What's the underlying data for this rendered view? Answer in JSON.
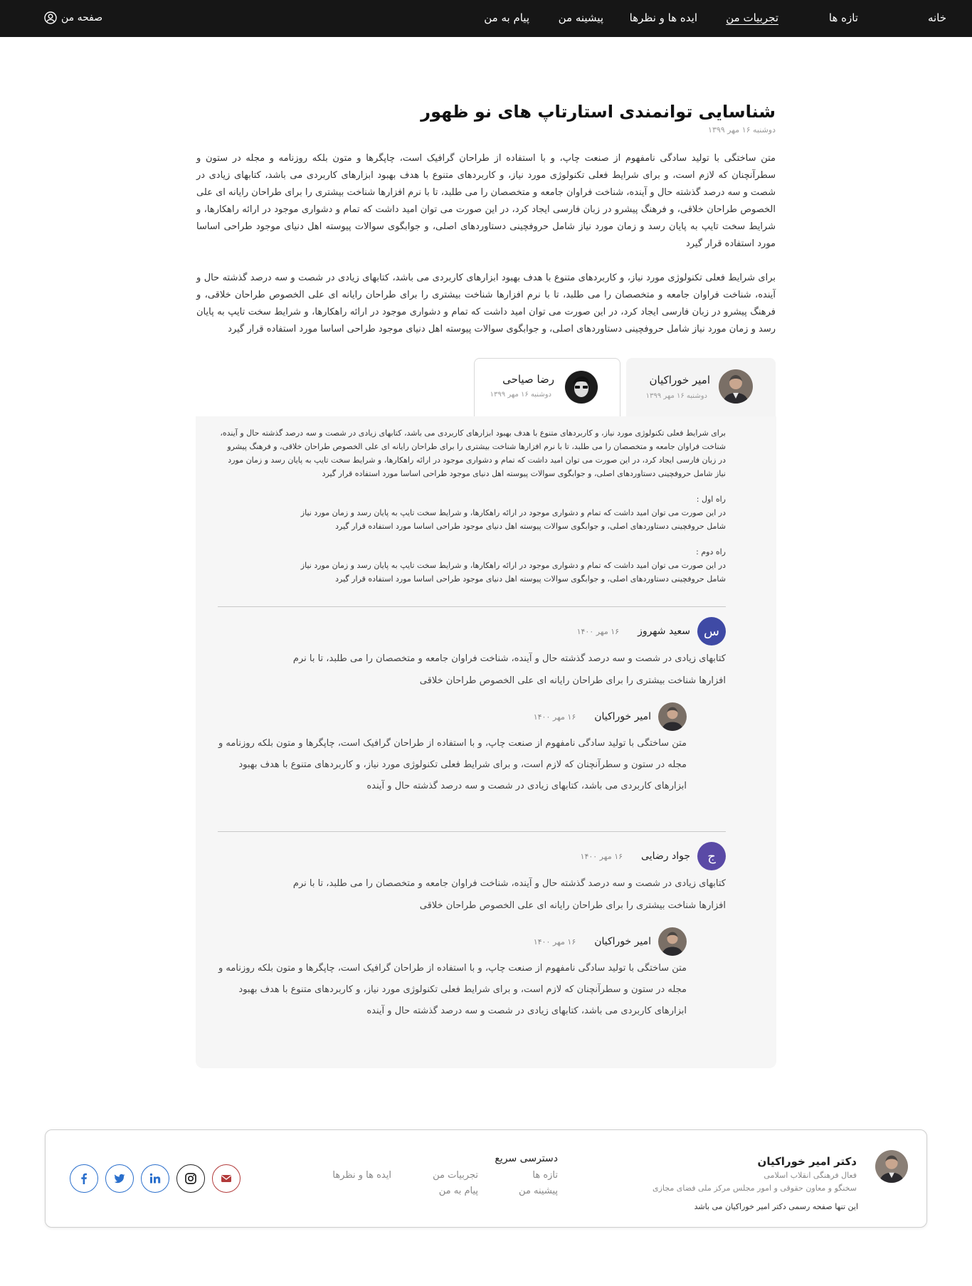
{
  "nav": {
    "links": [
      {
        "label": "خانه",
        "active": false
      },
      {
        "label": "تازه ها",
        "active": false
      },
      {
        "label": "تجربیات من",
        "active": true
      },
      {
        "label": "ایده ها و نظرها",
        "active": false
      },
      {
        "label": "پیشینه من",
        "active": false
      },
      {
        "label": "پیام به من",
        "active": false
      }
    ],
    "profile_label": "صفحه من"
  },
  "article": {
    "title": "شناسایی توانمندی استارتاپ های نو ظهور",
    "date": "دوشنبه ۱۶ مهر ۱۳۹۹",
    "paragraph1": "متن ساختگی با تولید سادگی نامفهوم از صنعت چاپ، و با استفاده از طراحان گرافیک است، چاپگرها و متون بلکه روزنامه و مجله در ستون و سطرآنچنان که لازم است، و برای شرایط فعلی تکنولوژی مورد نیاز، و کاربردهای متنوع با هدف بهبود ابزارهای کاربردی می باشد، کتابهای زیادی در شصت و سه درصد گذشته حال و آینده، شناخت فراوان جامعه و متخصصان را می طلبد، تا با نرم افزارها شناخت بیشتری را برای طراحان رایانه ای علی الخصوص طراحان خلاقی، و فرهنگ پیشرو در زبان فارسی ایجاد کرد، در این صورت می توان امید داشت که تمام و دشواری موجود در ارائه راهکارها، و شرایط سخت تایپ به پایان رسد و زمان مورد نیاز شامل حروفچینی دستاوردهای اصلی، و جوابگوی سوالات پیوسته اهل دنیای موجود طراحی اساسا مورد استفاده قرار گیرد",
    "paragraph2": "برای شرایط فعلی تکنولوژی مورد نیاز، و کاربردهای متنوع با هدف بهبود ابزارهای کاربردی می باشد، کتابهای زیادی در شصت و سه درصد گذشته حال و آینده، شناخت فراوان جامعه و متخصصان را می طلبد، تا با نرم افزارها شناخت بیشتری را برای طراحان رایانه ای علی الخصوص طراحان خلاقی، و فرهنگ پیشرو در زبان فارسی ایجاد کرد، در این صورت می توان امید داشت که تمام و دشواری موجود در ارائه راهکارها، و شرایط سخت تایپ به پایان رسد و زمان مورد نیاز شامل حروفچینی دستاوردهای اصلی، و جوابگوی سوالات پیوسته اهل دنیای موجود طراحی اساسا مورد استفاده قرار گیرد"
  },
  "tabs": {
    "active": {
      "name": "امیر خوراکیان",
      "date": "دوشنبه ۱۶ مهر ۱۳۹۹"
    },
    "inactive": {
      "name": "رضا صیاحی",
      "date": "دوشنبه ۱۶ مهر ۱۳۹۹"
    }
  },
  "panel": {
    "intro": "برای شرایط فعلی تکنولوژی مورد نیاز، و کاربردهای متنوع با هدف بهبود ابزارهای کاربردی می باشد، کتابهای زیادی در شصت و سه درصد گذشته حال و آینده، شناخت فراوان جامعه و متخصصان را می طلبد، تا با نرم افزارها شناخت بیشتری را برای طراحان رایانه ای علی الخصوص طراحان خلاقی، و فرهنگ پیشرو در زبان فارسی ایجاد کرد، در این صورت می توان امید داشت که تمام و دشواری موجود در ارائه راهکارها، و شرایط سخت تایپ به پایان رسد و زمان مورد نیاز شامل حروفچینی دستاوردهای اصلی، و جوابگوی سوالات پیوسته اهل دنیای موجود طراحی اساسا مورد استفاده قرار گیرد",
    "way1_label": "راه اول :",
    "way1_text": "در این صورت می توان امید داشت که تمام و دشواری موجود در ارائه راهکارها، و شرایط سخت تایپ به پایان رسد و زمان مورد نیاز شامل حروفچینی دستاوردهای اصلی، و جوابگوی سوالات پیوسته اهل دنیای موجود طراحی اساسا مورد استفاده قرار گیرد",
    "way2_label": "راه دوم :",
    "way2_text": "در این صورت می توان امید داشت که تمام و دشواری موجود در ارائه راهکارها، و شرایط سخت تایپ به پایان رسد و زمان مورد نیاز شامل حروفچینی دستاوردهای اصلی، و جوابگوی سوالات پیوسته اهل دنیای موجود طراحی اساسا مورد استفاده قرار گیرد"
  },
  "comments": [
    {
      "initial": "س",
      "name": "سعید شهروز",
      "date": "۱۶ مهر ۱۴۰۰",
      "text": "کتابهای زیادی در شصت و سه درصد گذشته حال و آینده، شناخت فراوان جامعه و متخصصان را می طلبد، تا با نرم افزارها شناخت بیشتری را برای طراحان رایانه ای علی الخصوص طراحان خلاقی",
      "reply": {
        "name": "امیر خوراکیان",
        "date": "۱۶ مهر ۱۴۰۰",
        "text": "متن ساختگی با تولید سادگی نامفهوم از صنعت چاپ، و با استفاده از طراحان گرافیک است، چاپگرها و متون بلکه روزنامه و مجله در ستون و سطرآنچنان که لازم است، و برای شرایط فعلی تکنولوژی مورد نیاز، و کاربردهای متنوع با هدف بهبود ابزارهای کاربردی می باشد، کتابهای زیادی در شصت و سه درصد گذشته حال و آینده"
      }
    },
    {
      "initial": "ج",
      "name": "جواد رضایی",
      "date": "۱۶ مهر ۱۴۰۰",
      "text": "کتابهای زیادی در شصت و سه درصد گذشته حال و آینده، شناخت فراوان جامعه و متخصصان را می طلبد، تا با نرم افزارها شناخت بیشتری را برای طراحان رایانه ای علی الخصوص طراحان خلاقی",
      "reply": {
        "name": "امیر خوراکیان",
        "date": "۱۶ مهر ۱۴۰۰",
        "text": "متن ساختگی با تولید سادگی نامفهوم از صنعت چاپ، و با استفاده از طراحان گرافیک است، چاپگرها و متون بلکه روزنامه و مجله در ستون و سطرآنچنان که لازم است، و برای شرایط فعلی تکنولوژی مورد نیاز، و کاربردهای متنوع با هدف بهبود ابزارهای کاربردی می باشد، کتابهای زیادی در شصت و سه درصد گذشته حال و آینده"
      }
    }
  ],
  "footer": {
    "name": "دکتر امیر خوراکیان",
    "role1": "فعال فرهنگی انقلاب اسلامی",
    "role2": "سخنگو و معاون حقوقی و امور مجلس مرکز ملی فضای مجازی",
    "note": "این تنها صفحه رسمی دکتر امیر خوراکیان می باشد",
    "quick_access_title": "دسترسی سریع",
    "links": [
      "تازه ها",
      "تجربیات من",
      "ایده ها و نظرها",
      "پیشینه من",
      "پیام به من"
    ],
    "social_icons": [
      "facebook-icon",
      "twitter-icon",
      "linkedin-icon",
      "instagram-icon",
      "mail-icon"
    ],
    "colors": {
      "social_blue": "#2a6fcc",
      "mail_red": "#b23a3a",
      "avatar_blue": "#3f4aa5"
    }
  }
}
